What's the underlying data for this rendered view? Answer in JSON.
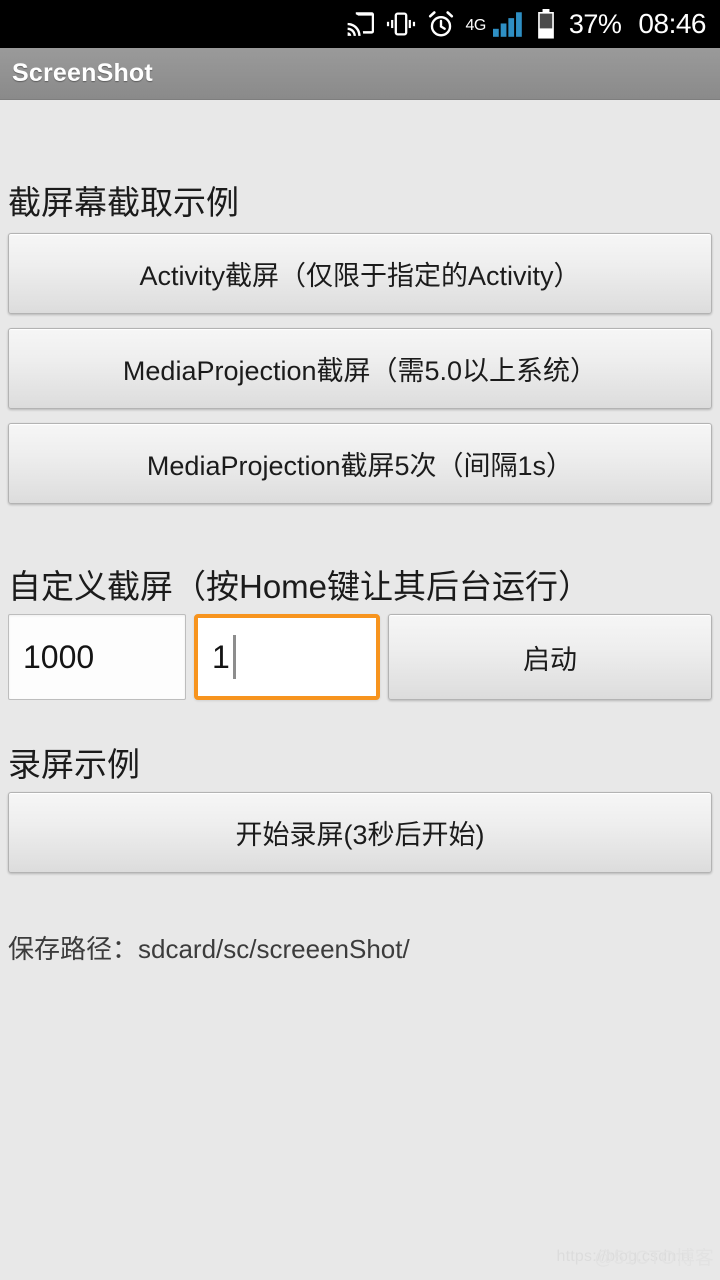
{
  "status_bar": {
    "icons": [
      {
        "name": "cast-icon",
        "label": "cast"
      },
      {
        "name": "vibrate-icon",
        "label": "vibrate"
      },
      {
        "name": "alarm-icon",
        "label": "alarm"
      }
    ],
    "network_label": "4G",
    "signal_bars": 4,
    "battery_percent": "37%",
    "battery_level": 37,
    "time": "08:46"
  },
  "title_bar": {
    "app_title": "ScreenShot"
  },
  "sections": {
    "capture": {
      "heading": "截屏幕截取示例",
      "buttons": [
        {
          "id": "activity-capture",
          "label": "Activity截屏（仅限于指定的Activity）"
        },
        {
          "id": "mediaprojection-capture",
          "label": "MediaProjection截屏（需5.0以上系统）"
        },
        {
          "id": "mediaprojection-capture-5x",
          "label": "MediaProjection截屏5次（间隔1s）"
        }
      ]
    },
    "custom": {
      "heading": "自定义截屏（按Home键让其后台运行）",
      "interval_input": {
        "value": "1000",
        "placeholder": "1000"
      },
      "count_input": {
        "value": "1",
        "placeholder": "1",
        "focused": true
      },
      "start_button": {
        "label": "启动"
      }
    },
    "record": {
      "heading": "录屏示例",
      "button": {
        "label": "开始录屏(3秒后开始)"
      }
    }
  },
  "save_path": "保存路径：sdcard/sc/screeenShot/",
  "watermark": {
    "url": "https://blog.csdn.n",
    "brand": "@51CTO博客"
  },
  "colors": {
    "focus_orange": "#f7941e",
    "status_bar_bg": "#000000",
    "title_bar_bg": "#939393",
    "page_bg": "#e8e8e8",
    "signal_blue": "#2e8fc4"
  }
}
